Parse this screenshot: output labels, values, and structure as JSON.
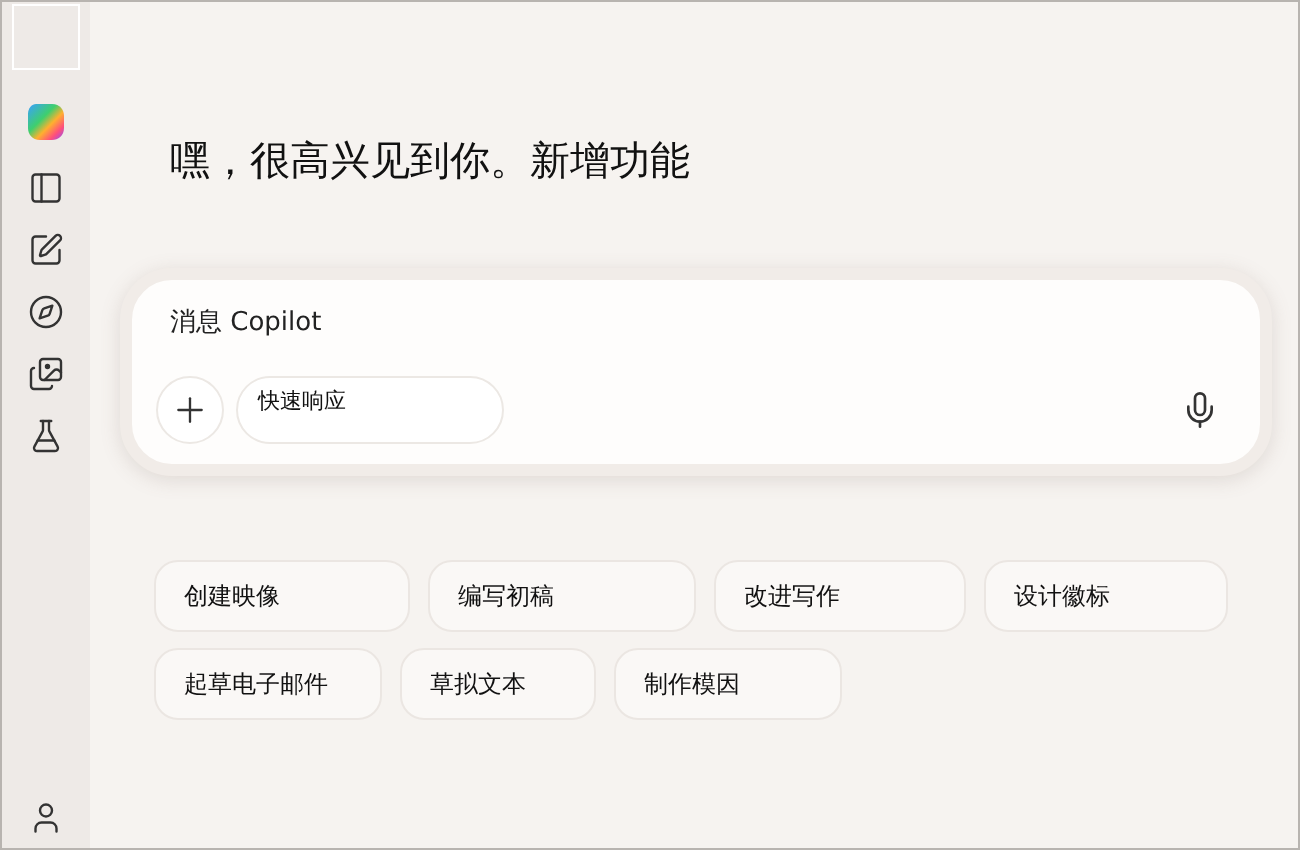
{
  "greeting": "嘿，很高兴见到你。新增功能",
  "composer": {
    "placeholder": "消息 Copilot",
    "mode": "快速响应"
  },
  "suggestions": [
    {
      "label": "创建映像"
    },
    {
      "label": "编写初稿"
    },
    {
      "label": "改进写作"
    },
    {
      "label": "设计徽标"
    },
    {
      "label": "起草电子邮件"
    },
    {
      "label": "草拟文本"
    },
    {
      "label": "制作模因"
    }
  ]
}
